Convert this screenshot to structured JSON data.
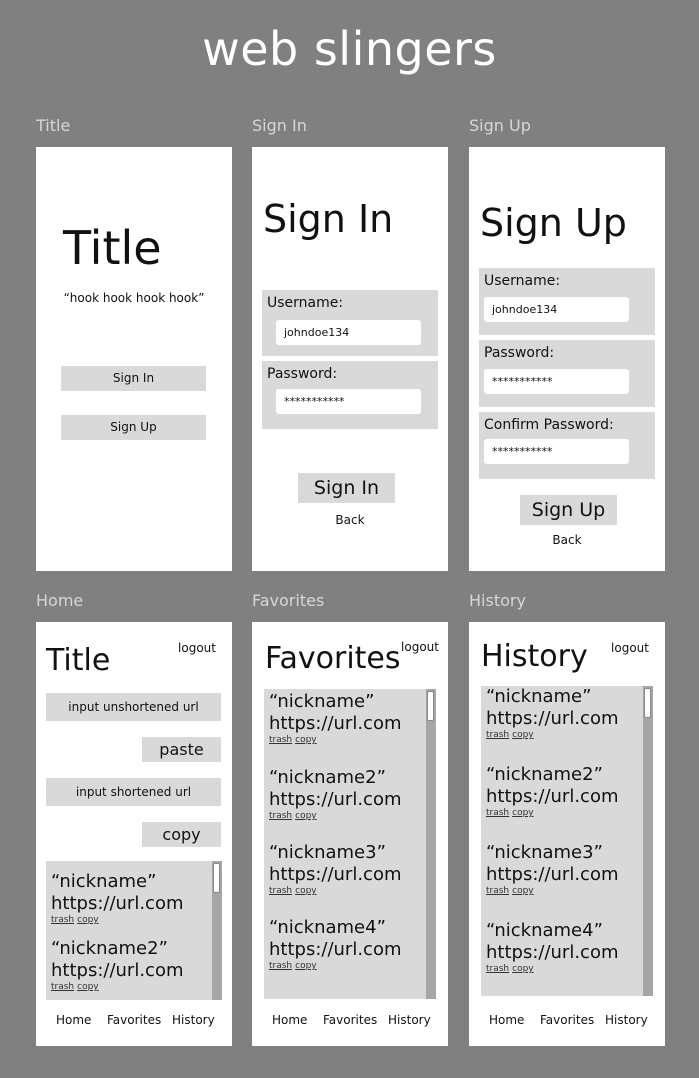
{
  "header": {
    "title": "web slingers"
  },
  "labels": {
    "title": "Title",
    "signin": "Sign In",
    "signup": "Sign Up",
    "home": "Home",
    "favorites": "Favorites",
    "history": "History"
  },
  "title_screen": {
    "heading": "Title",
    "tagline": "“hook hook hook hook”",
    "signin_button": "Sign In",
    "signup_button": "Sign Up"
  },
  "signin_screen": {
    "heading": "Sign In",
    "username_label": "Username:",
    "username_value": "johndoe134",
    "password_label": "Password:",
    "password_value": "***********",
    "submit": "Sign In",
    "back": "Back"
  },
  "signup_screen": {
    "heading": "Sign Up",
    "username_label": "Username:",
    "username_value": "johndoe134",
    "password_label": "Password:",
    "password_value": "***********",
    "confirm_label": "Confirm Password:",
    "confirm_value": "***********",
    "submit": "Sign Up",
    "back": "Back"
  },
  "home_screen": {
    "heading": "Title",
    "logout": "logout",
    "unshortened_placeholder": "input unshortened url",
    "paste": "paste",
    "shortened_placeholder": "input shortened url",
    "copy": "copy",
    "items": [
      {
        "nickname": "“nickname”",
        "url": "https://url.com",
        "trash": "trash",
        "copy": "copy"
      },
      {
        "nickname": "“nickname2”",
        "url": "https://url.com",
        "trash": "trash",
        "copy": "copy"
      }
    ]
  },
  "favorites_screen": {
    "heading": "Favorites",
    "logout": "logout",
    "items": [
      {
        "nickname": "“nickname”",
        "url": "https://url.com",
        "trash": "trash",
        "copy": "copy"
      },
      {
        "nickname": "“nickname2”",
        "url": "https://url.com",
        "trash": "trash",
        "copy": "copy"
      },
      {
        "nickname": "“nickname3”",
        "url": "https://url.com",
        "trash": "trash",
        "copy": "copy"
      },
      {
        "nickname": "“nickname4”",
        "url": "https://url.com",
        "trash": "trash",
        "copy": "copy"
      }
    ]
  },
  "history_screen": {
    "heading": "History",
    "logout": "logout",
    "items": [
      {
        "nickname": "“nickname”",
        "url": "https://url.com",
        "trash": "trash",
        "copy": "copy"
      },
      {
        "nickname": "“nickname2”",
        "url": "https://url.com",
        "trash": "trash",
        "copy": "copy"
      },
      {
        "nickname": "“nickname3”",
        "url": "https://url.com",
        "trash": "trash",
        "copy": "copy"
      },
      {
        "nickname": "“nickname4”",
        "url": "https://url.com",
        "trash": "trash",
        "copy": "copy"
      }
    ]
  },
  "nav": {
    "home": "Home",
    "favorites": "Favorites",
    "history": "History"
  }
}
